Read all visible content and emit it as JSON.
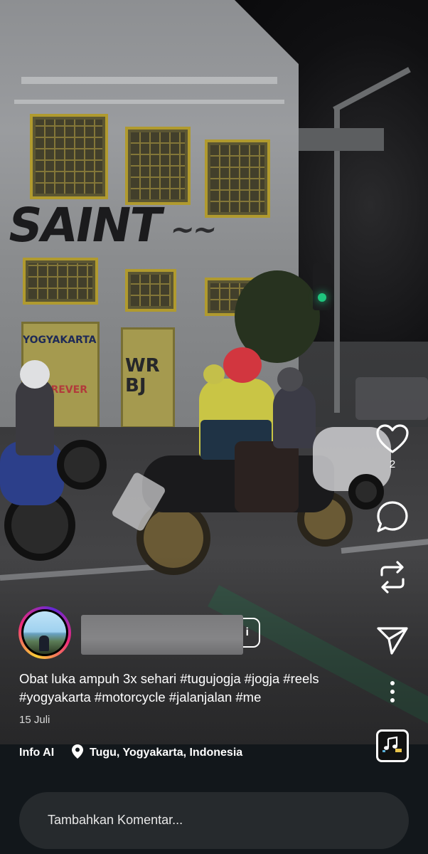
{
  "post": {
    "caption": "Obat luka ampuh 3x sehari #tugujogja #jogja #reels #yogyakarta #motorcycle #jalanjalan #me",
    "date": "15 Juli",
    "like_count": "2",
    "follow_partial": "i"
  },
  "scene_text": {
    "graffiti_main": "SAINT",
    "graffiti_side": "YOGYAKARTA",
    "graffiti_forever": "FOREVER",
    "door_text": "WR BJ"
  },
  "footer": {
    "info_ai": "Info AI",
    "location": "Tugu, Yogyakarta, Indonesia"
  },
  "comment": {
    "placeholder": "Tambahkan Komentar..."
  },
  "icons": {
    "like": "heart-icon",
    "comment": "comment-bubble-icon",
    "repost": "repost-icon",
    "share": "send-icon",
    "more": "more-vertical-icon",
    "audio": "music-audio-icon",
    "location": "location-pin-icon"
  }
}
